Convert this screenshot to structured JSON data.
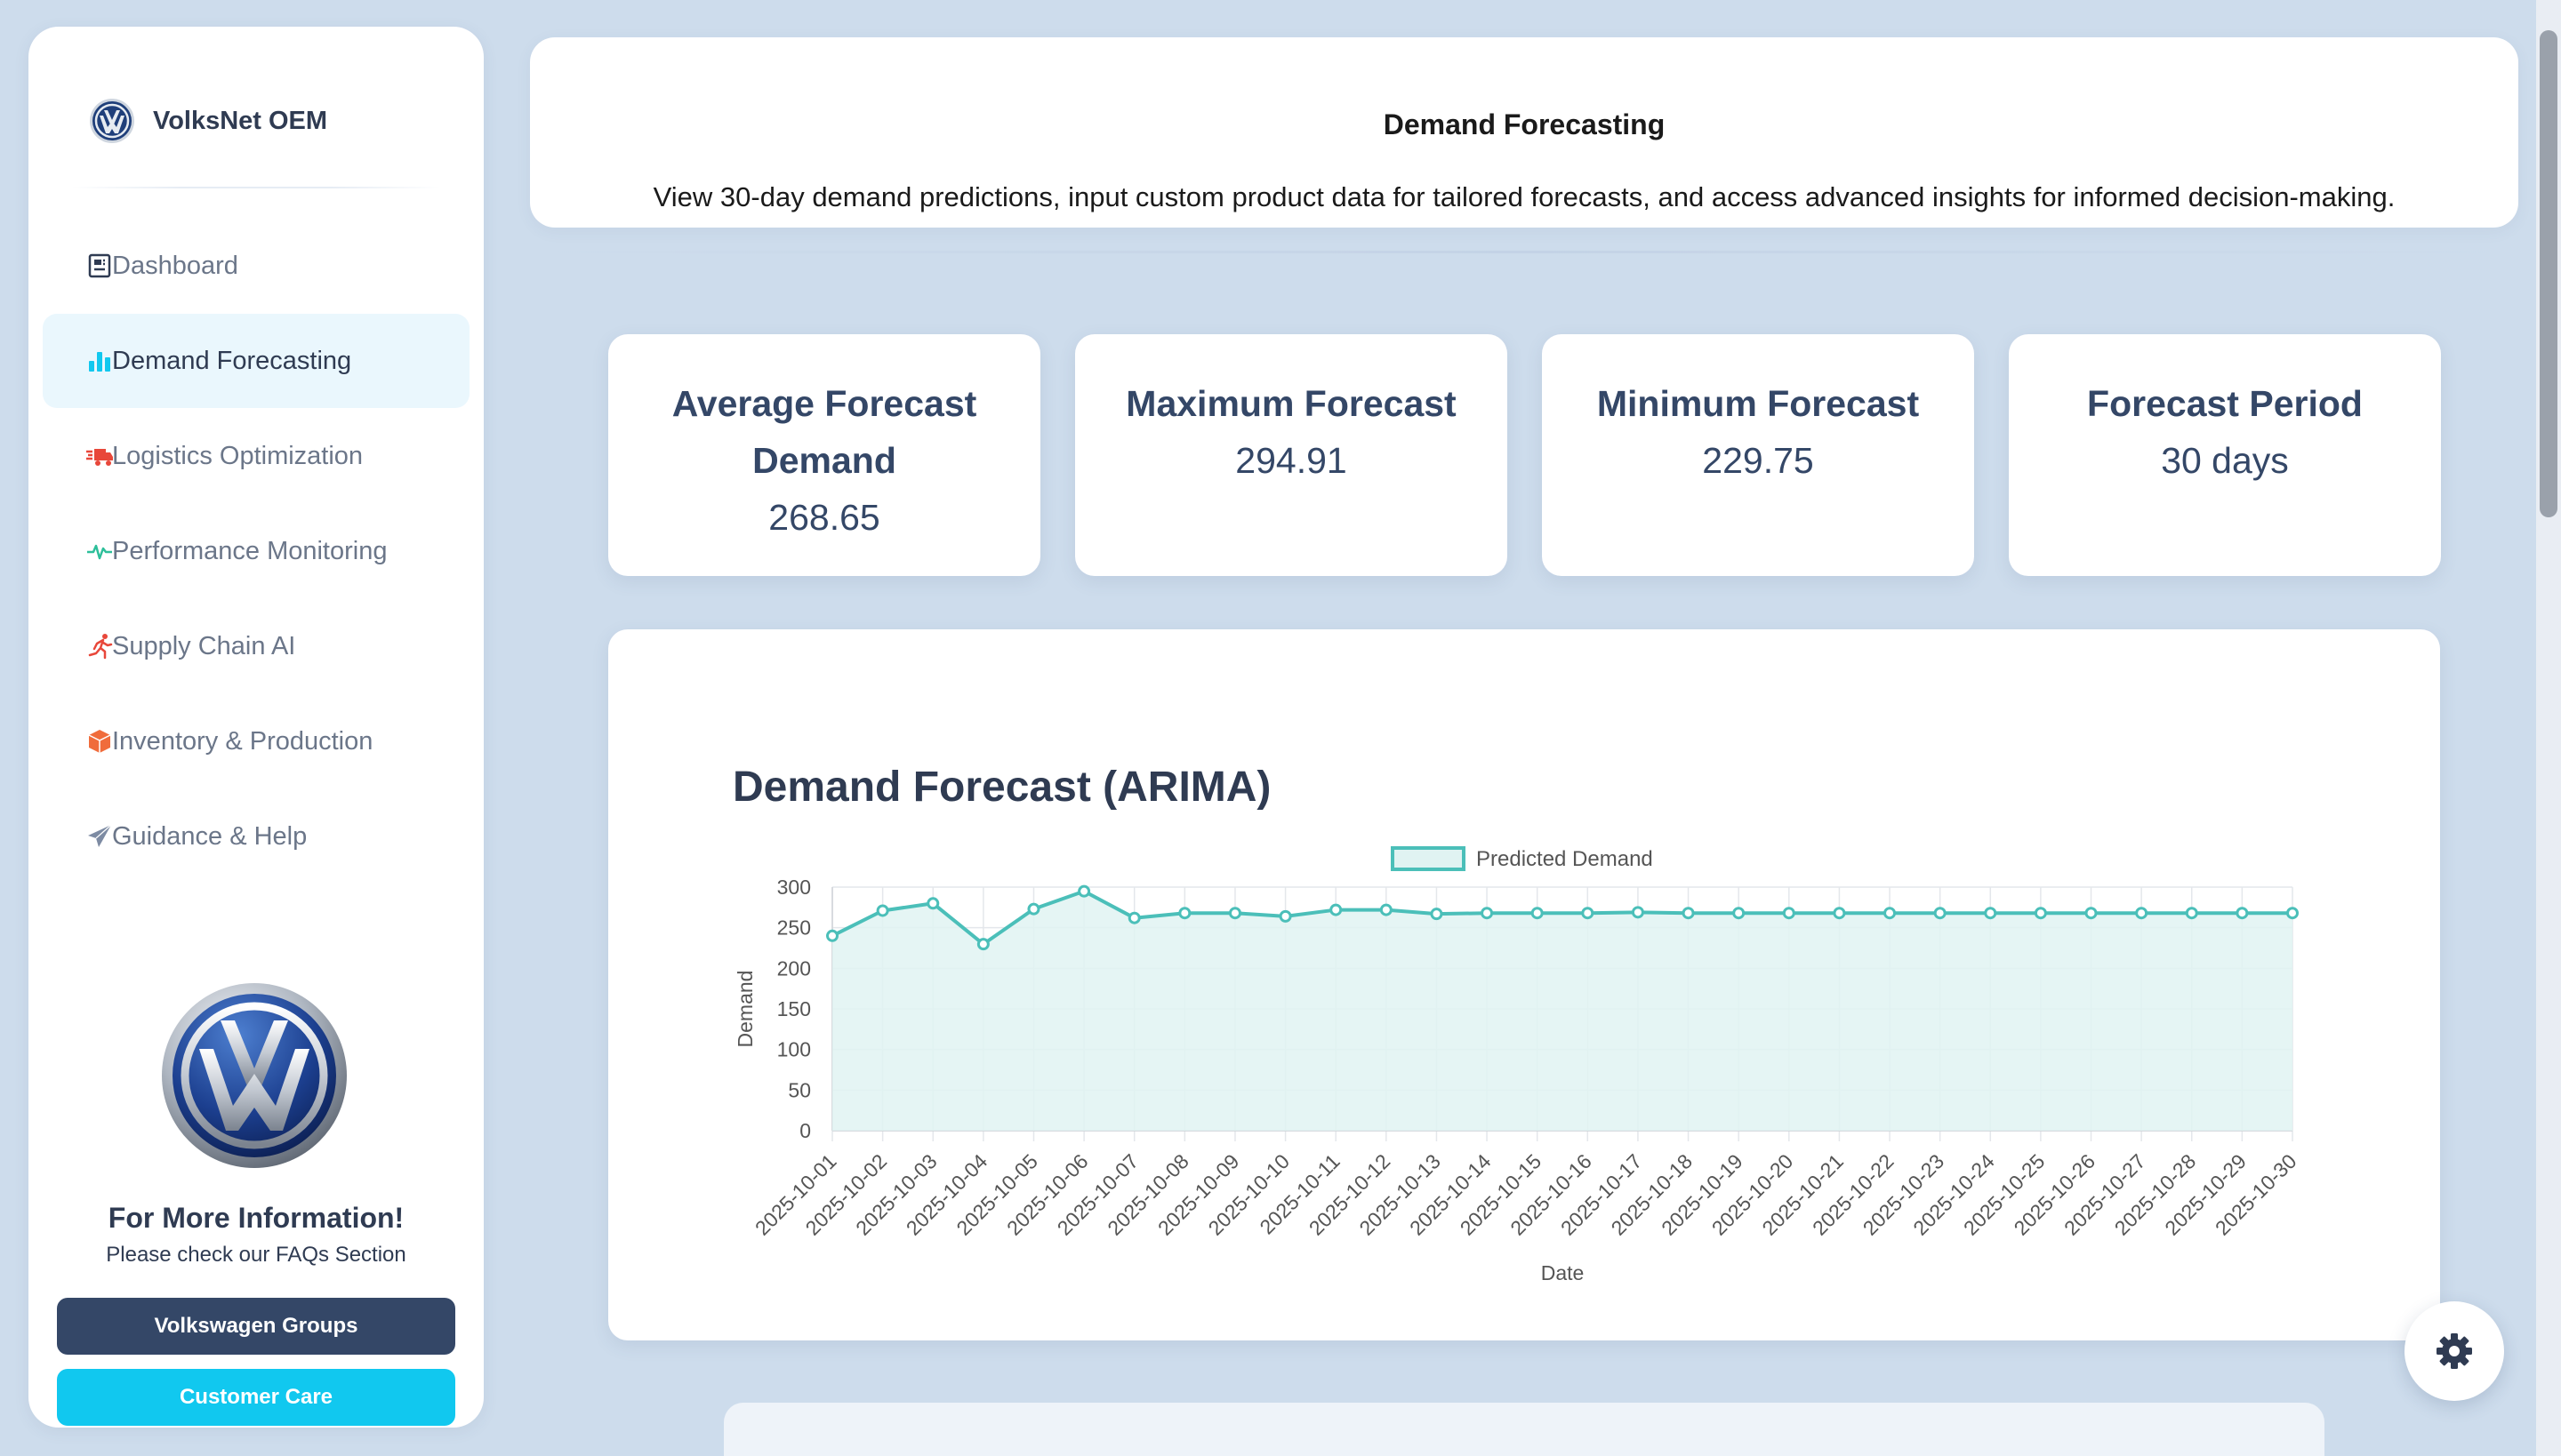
{
  "brand": {
    "name": "VolksNet OEM"
  },
  "sidebar": {
    "items": [
      {
        "label": "Dashboard",
        "icon": "dashboard-icon",
        "active": false
      },
      {
        "label": "Demand Forecasting",
        "icon": "bar-chart-icon",
        "active": true
      },
      {
        "label": "Logistics Optimization",
        "icon": "truck-fast-icon",
        "active": false
      },
      {
        "label": "Performance Monitoring",
        "icon": "pulse-icon",
        "active": false
      },
      {
        "label": "Supply Chain AI",
        "icon": "runner-icon",
        "active": false
      },
      {
        "label": "Inventory & Production",
        "icon": "box-icon",
        "active": false
      },
      {
        "label": "Guidance & Help",
        "icon": "paper-plane-icon",
        "active": false
      }
    ],
    "info_title": "For More Information!",
    "info_subtitle": "Please check our FAQs Section",
    "btn_groups": "Volkswagen Groups",
    "btn_care": "Customer Care"
  },
  "header": {
    "title": "Demand Forecasting",
    "description": "View 30-day demand predictions, input custom product data for tailored forecasts, and access advanced insights for informed decision-making."
  },
  "stats": [
    {
      "title": "Average Forecast Demand",
      "value": "268.65"
    },
    {
      "title": "Maximum Forecast",
      "value": "294.91"
    },
    {
      "title": "Minimum Forecast",
      "value": "229.75"
    },
    {
      "title": "Forecast Period",
      "value": "30 days"
    }
  ],
  "chart_title": "Demand Forecast (ARIMA)",
  "colors": {
    "accent": "#11c8ef",
    "nav_active_bg": "#eaf7fd",
    "primary_dark": "#344767",
    "series_line": "#4bbfb9",
    "series_fill": "#e0f3f2"
  },
  "chart_data": {
    "type": "area",
    "title": "Demand Forecast (ARIMA)",
    "xlabel": "Date",
    "ylabel": "Demand",
    "ylim": [
      0,
      300
    ],
    "yticks": [
      0,
      50,
      100,
      150,
      200,
      250,
      300
    ],
    "grid": true,
    "legend": "top-center",
    "x": [
      "2025-10-01",
      "2025-10-02",
      "2025-10-03",
      "2025-10-04",
      "2025-10-05",
      "2025-10-06",
      "2025-10-07",
      "2025-10-08",
      "2025-10-09",
      "2025-10-10",
      "2025-10-11",
      "2025-10-12",
      "2025-10-13",
      "2025-10-14",
      "2025-10-15",
      "2025-10-16",
      "2025-10-17",
      "2025-10-18",
      "2025-10-19",
      "2025-10-20",
      "2025-10-21",
      "2025-10-22",
      "2025-10-23",
      "2025-10-24",
      "2025-10-25",
      "2025-10-26",
      "2025-10-27",
      "2025-10-28",
      "2025-10-29",
      "2025-10-30"
    ],
    "series": [
      {
        "name": "Predicted Demand",
        "values": [
          240,
          271,
          280,
          229.75,
          273,
          294.91,
          262,
          268,
          268,
          264,
          272,
          272,
          267,
          268,
          268,
          268,
          269,
          268,
          268,
          268,
          268,
          268,
          268,
          268,
          268,
          268,
          268,
          268,
          268,
          268
        ]
      }
    ]
  }
}
